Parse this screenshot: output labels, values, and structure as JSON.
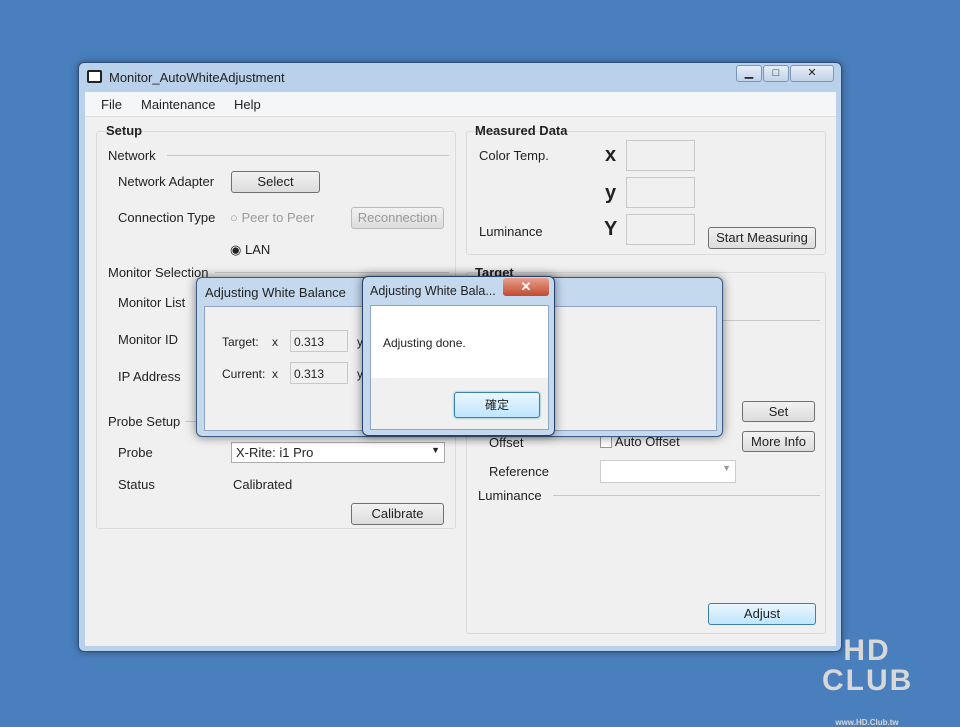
{
  "window": {
    "title": "Monitor_AutoWhiteAdjustment",
    "minimize": "▁",
    "maximize": "□",
    "close": "✕"
  },
  "menu": [
    "File",
    "Maintenance",
    "Help"
  ],
  "setup": {
    "title": "Setup",
    "network": "Network",
    "network_adapter": "Network Adapter",
    "select": "Select",
    "connection_type": "Connection Type",
    "peer_to_peer": "Peer to Peer",
    "reconnection": "Reconnection",
    "lan": "LAN",
    "monitor_selection": "Monitor Selection",
    "monitor_list": "Monitor List",
    "monitor_id": "Monitor ID",
    "ip_address": "IP Address",
    "probe_setup": "Probe Setup",
    "probe": "Probe",
    "probe_value": "X-Rite: i1 Pro",
    "status": "Status",
    "status_value": "Calibrated",
    "calibrate": "Calibrate"
  },
  "measured": {
    "title": "Measured Data",
    "color_temp": "Color Temp.",
    "x": "x",
    "y": "y",
    "Y": "Y",
    "luminance": "Luminance",
    "start": "Start Measuring"
  },
  "target": {
    "title": "Target",
    "set": "Set",
    "offset": "Offset",
    "auto_offset": "Auto Offset",
    "more_info": "More Info",
    "reference": "Reference",
    "luminance": "Luminance",
    "adjust": "Adjust"
  },
  "progress_dialog": {
    "title": "Adjusting White Balance",
    "target_label": "Target:",
    "current_label": "Current:",
    "x": "x",
    "y": "y",
    "target_x": "0.313",
    "current_x": "0.313"
  },
  "message_box": {
    "title": "Adjusting White Bala...",
    "message": "Adjusting done.",
    "ok": "確定",
    "close": "✕"
  },
  "watermark": {
    "text": "HD CLUB",
    "url": "www.HD.Club.tw"
  }
}
